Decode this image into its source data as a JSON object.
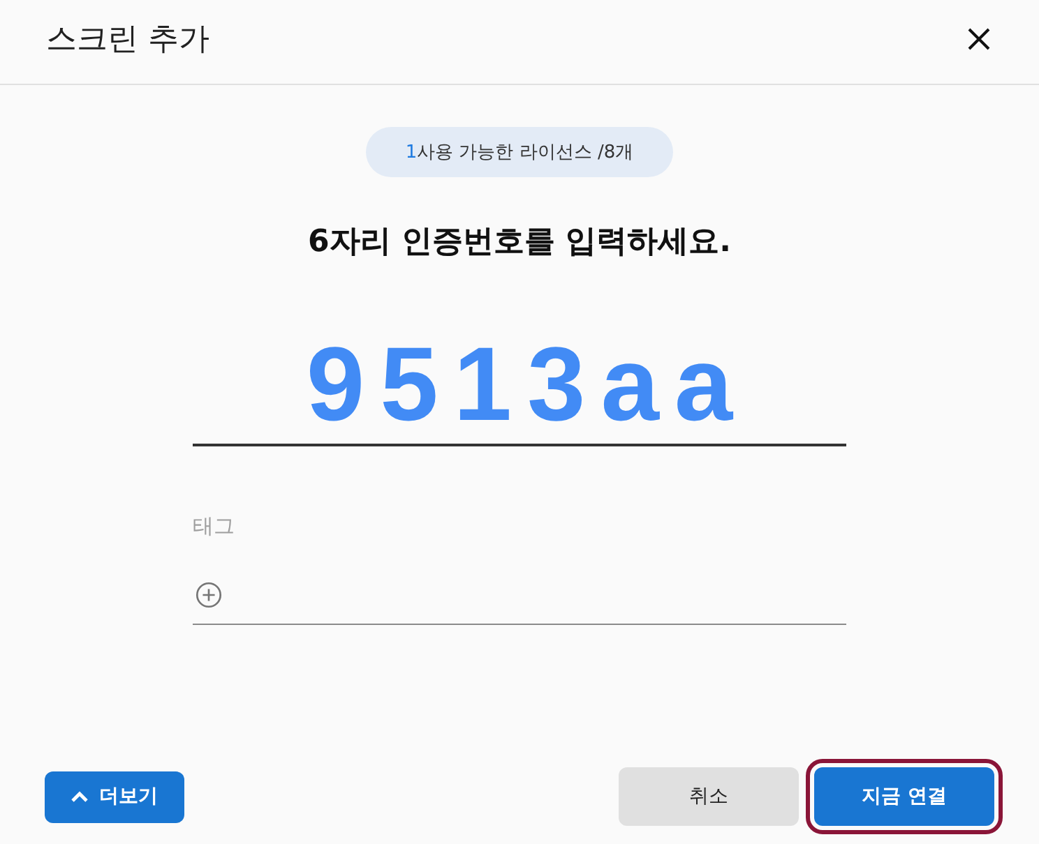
{
  "dialog": {
    "title": "스크린 추가"
  },
  "license_badge": {
    "count": "1",
    "text": "사용 가능한 라이선스 /8개"
  },
  "prompt": "6자리 인증번호를 입력하세요.",
  "code_field": {
    "value": "9513aa"
  },
  "tag_field": {
    "label": "태그"
  },
  "buttons": [
    {
      "kind": "expand",
      "label": "더보기",
      "focused": false
    },
    {
      "kind": "secondary",
      "label": "취소",
      "focused": false
    },
    {
      "kind": "primary",
      "label": "지금 연결",
      "focused": true
    }
  ]
}
